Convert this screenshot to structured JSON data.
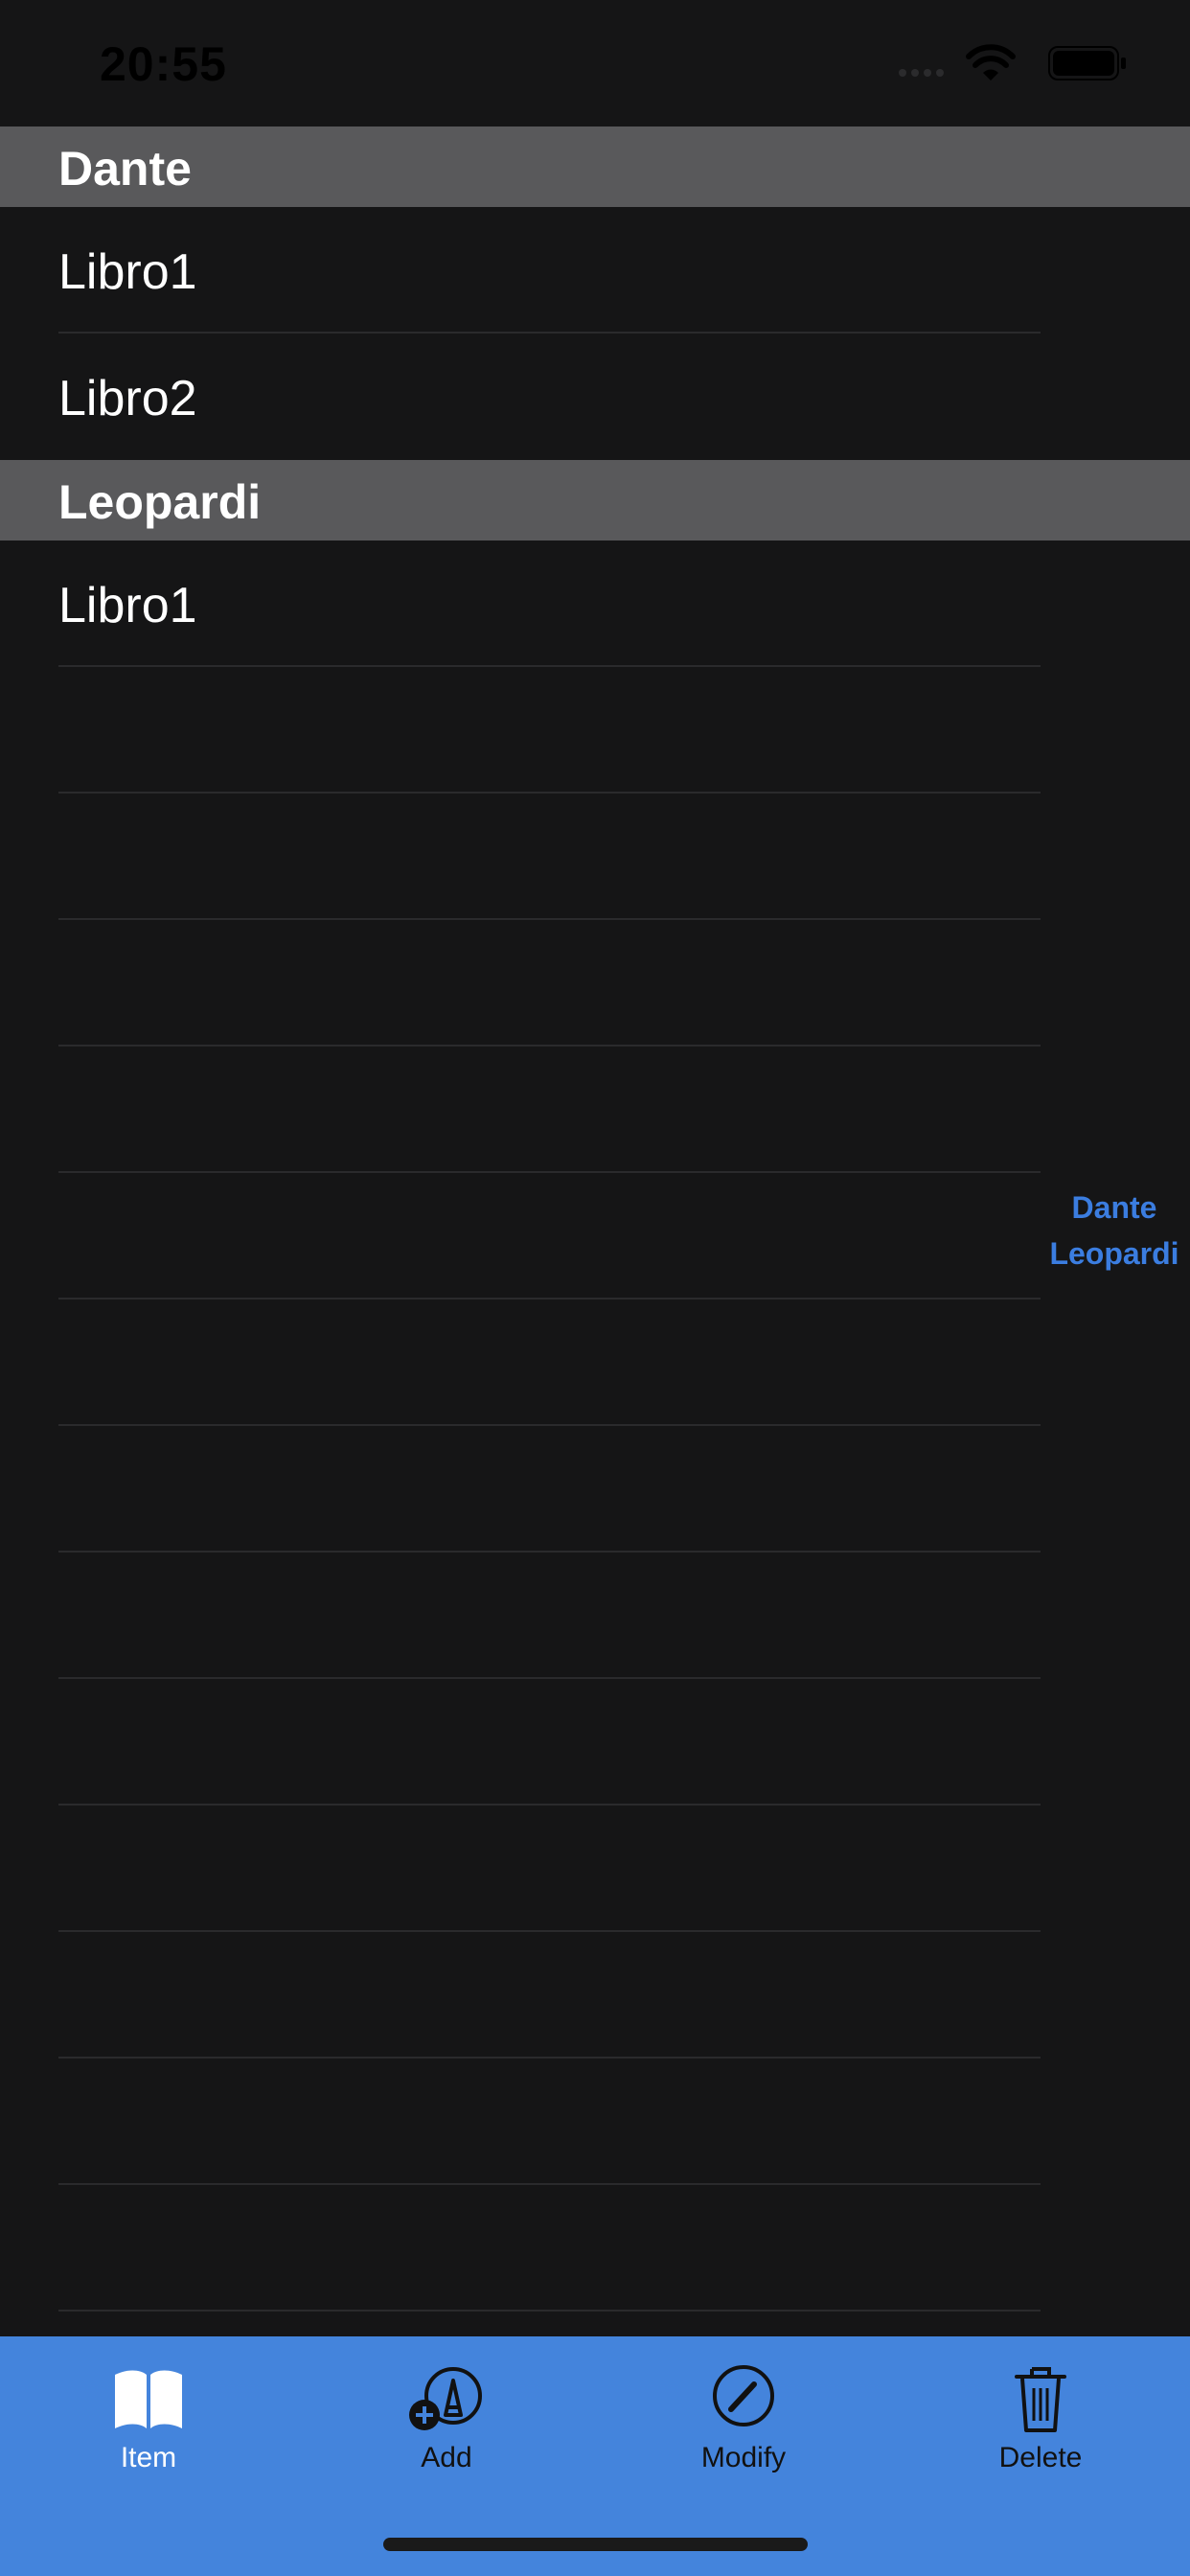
{
  "status_bar": {
    "time": "20:55"
  },
  "sections": [
    {
      "title": "Dante",
      "rows": [
        "Libro1",
        "Libro2"
      ]
    },
    {
      "title": "Leopardi",
      "rows": [
        "Libro1"
      ]
    }
  ],
  "empty_row_count": 13,
  "section_index": [
    "Dante",
    "Leopardi"
  ],
  "tab_bar": {
    "active_tab": "Item",
    "tabs": [
      {
        "label": "Item",
        "icon": "book-icon"
      },
      {
        "label": "Add",
        "icon": "add-pencil-icon"
      },
      {
        "label": "Modify",
        "icon": "pencil-circle-icon"
      },
      {
        "label": "Delete",
        "icon": "trash-icon"
      }
    ]
  },
  "colors": {
    "background": "#151516",
    "section_header": "#59595b",
    "accent": "#3b7de0",
    "tab_bar": "#4484dc"
  }
}
